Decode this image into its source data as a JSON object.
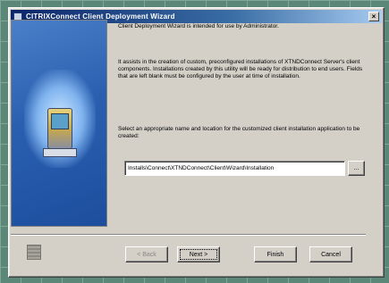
{
  "window": {
    "title": "CITRIXConnect Client Deployment Wizard",
    "close_label": "×"
  },
  "content": {
    "paragraph1": "Client Deployment Wizard is intended for use by Administrator.",
    "paragraph2": "It assists in the creation of custom, preconfigured installations of XTNDConnect Server's client components. Installations created by this utility will be ready for distribution to end users. Fields that are left blank must be configured by the user at time of installation.",
    "paragraph3": "Select an appropriate name and location for the customized client installation application to be created:",
    "path_value": "Installs\\Connect\\XTNDConnect\\Client\\Wizard\\Installation",
    "browse_label": "..."
  },
  "buttons": {
    "back": "< Back",
    "next": "Next >",
    "finish": "Finish",
    "cancel": "Cancel"
  },
  "icons": {
    "title_icon": "app-icon",
    "side_art": "pda-device-illustration",
    "bottom_logo": "company-logo-icon"
  }
}
